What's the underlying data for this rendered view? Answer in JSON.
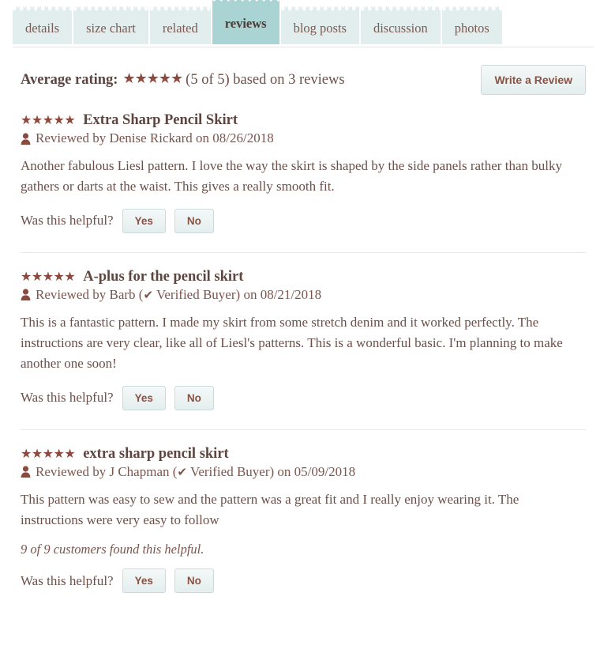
{
  "tabs": [
    {
      "label": "details",
      "active": false
    },
    {
      "label": "size chart",
      "active": false
    },
    {
      "label": "related",
      "active": false
    },
    {
      "label": "reviews",
      "active": true
    },
    {
      "label": "blog posts",
      "active": false
    },
    {
      "label": "discussion",
      "active": false
    },
    {
      "label": "photos",
      "active": false
    }
  ],
  "summary": {
    "label": "Average rating:",
    "stars": "★★★★★",
    "rating_text": "(5 of 5) based on 3 reviews",
    "write_review_label": "Write a Review"
  },
  "helpful": {
    "question": "Was this helpful?",
    "yes_label": "Yes",
    "no_label": "No"
  },
  "verified_text": "Verified Buyer",
  "check_glyph": "✔",
  "reviews": [
    {
      "stars": "★★★★★",
      "title": "Extra Sharp Pencil Skirt",
      "byline_prefix": "Reviewed by Denise Rickard on 08/26/2018",
      "author": "Denise Rickard",
      "date": "08/26/2018",
      "verified": false,
      "body": "Another fabulous Liesl pattern. I love the way the skirt is shaped by the side panels rather than bulky gathers or darts at the waist. This gives a really smooth fit.",
      "helpful_count_text": ""
    },
    {
      "stars": "★★★★★",
      "title": "A-plus for the pencil skirt",
      "byline_prefix": "Reviewed by Barb (",
      "byline_suffix": ") on 08/21/2018",
      "author": "Barb",
      "date": "08/21/2018",
      "verified": true,
      "body": "This is a fantastic pattern. I made my skirt from some stretch denim and it worked perfectly. The instructions are very clear, like all of Liesl's patterns. This is a wonderful basic. I'm planning to make another one soon!",
      "helpful_count_text": ""
    },
    {
      "stars": "★★★★★",
      "title": "extra sharp pencil skirt",
      "byline_prefix": "Reviewed by J Chapman (",
      "byline_suffix": ") on 05/09/2018",
      "author": "J Chapman",
      "date": "05/09/2018",
      "verified": true,
      "body": "This pattern was easy to sew and the pattern was a great fit and I really enjoy wearing it. The instructions were very easy to follow",
      "helpful_count_text": "9 of 9 customers found this helpful."
    }
  ],
  "colors": {
    "star": "#8c4a3f",
    "tab_active_bg": "#a9d4d3",
    "tab_bg": "#e2eeee",
    "text": "#6b5049",
    "button_text": "#8a5244"
  }
}
